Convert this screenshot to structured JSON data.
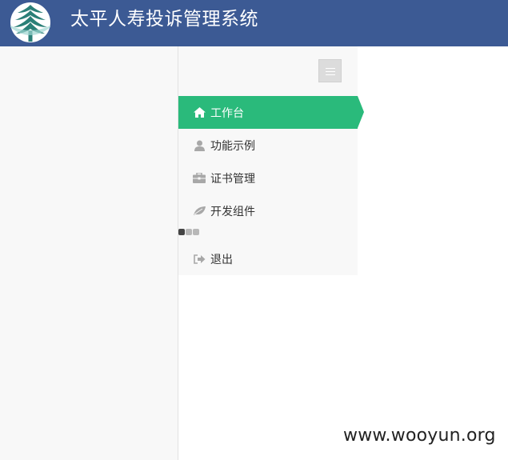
{
  "header": {
    "title": "太平人寿投诉管理系统",
    "logo_icon": "pine-tree-logo-icon",
    "background_color": "#3c5a94"
  },
  "sidebar": {
    "toggle_icon": "menu-toggle-icon",
    "items": [
      {
        "label": "工作台",
        "icon": "home-icon",
        "active": true
      },
      {
        "label": "功能示例",
        "icon": "user-icon",
        "active": false
      },
      {
        "label": "证书管理",
        "icon": "briefcase-icon",
        "active": false
      },
      {
        "label": "开发组件",
        "icon": "leaf-icon",
        "active": false
      }
    ],
    "logout": {
      "label": "退出",
      "icon": "sign-out-icon"
    },
    "active_color": "#2aba7b"
  },
  "watermark": {
    "text": "www.wooyun.org"
  }
}
